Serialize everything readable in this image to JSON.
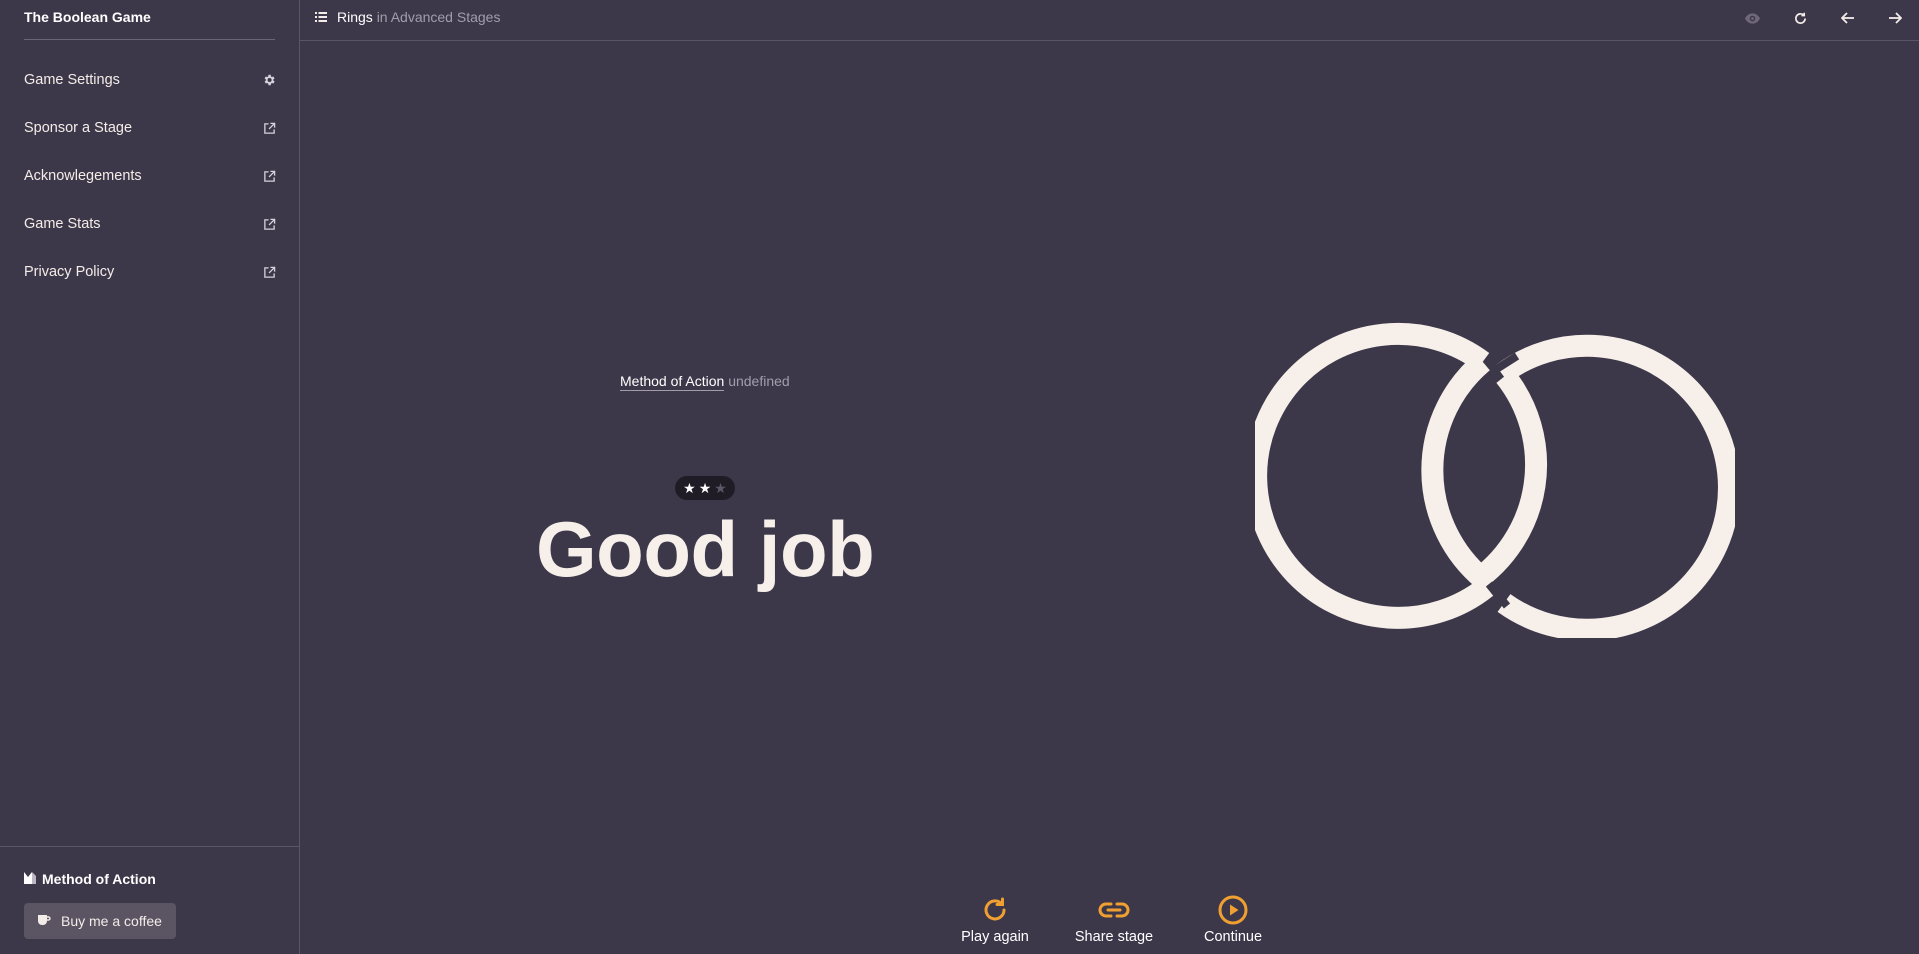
{
  "sidebar": {
    "brand": "The Boolean Game",
    "items": [
      {
        "label": "Game Settings",
        "icon": "gear-icon"
      },
      {
        "label": "Sponsor a Stage",
        "icon": "external-link-icon"
      },
      {
        "label": "Acknowlegements",
        "icon": "external-link-icon"
      },
      {
        "label": "Game Stats",
        "icon": "external-link-icon"
      },
      {
        "label": "Privacy Policy",
        "icon": "external-link-icon"
      }
    ],
    "footer": {
      "brand": "Method of Action",
      "coffee_label": "Buy me a coffee"
    }
  },
  "topbar": {
    "stage": "Rings",
    "group": "in Advanced Stages",
    "icons": [
      "eye-icon",
      "refresh-icon",
      "arrow-left-icon",
      "arrow-right-icon"
    ]
  },
  "result": {
    "method_link": "Method of Action",
    "method_suffix": "undefined",
    "stars_earned": 2,
    "stars_total": 3,
    "headline": "Good job"
  },
  "actions": {
    "play_again": "Play again",
    "share_stage": "Share stage",
    "continue": "Continue"
  },
  "colors": {
    "background": "#3d3849",
    "ring": "#f6efea",
    "accent": "#f0a030"
  }
}
